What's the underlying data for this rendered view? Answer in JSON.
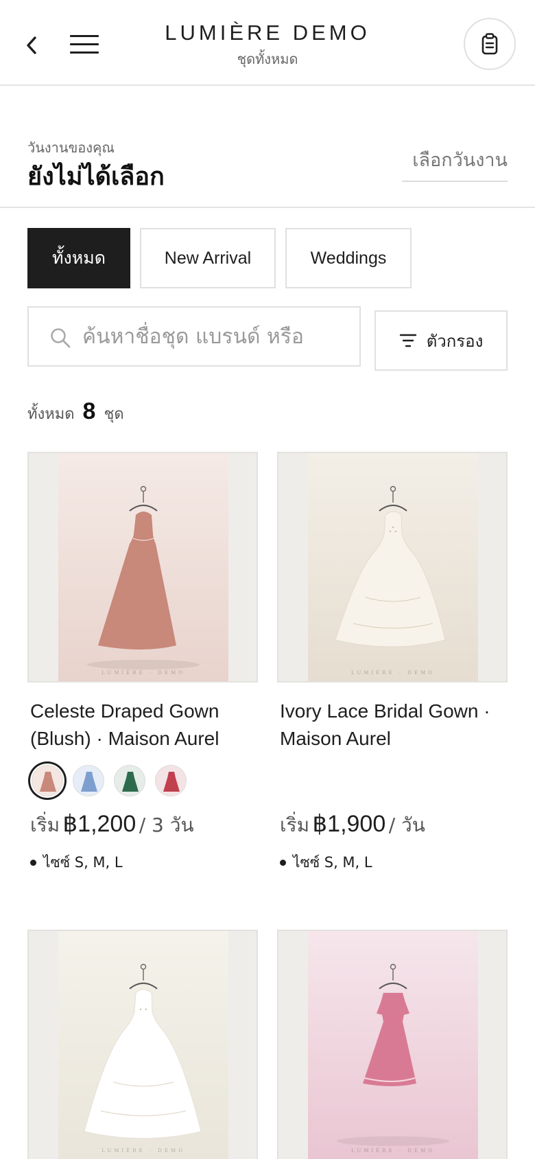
{
  "header": {
    "brand": "LUMIÈRE DEMO",
    "subtitle": "ชุดทั้งหมด"
  },
  "event_date": {
    "label": "วันงานของคุณ",
    "value": "ยังไม่ได้เลือก",
    "action": "เลือกวันงาน"
  },
  "tabs": [
    {
      "label": "ทั้งหมด",
      "active": true
    },
    {
      "label": "New Arrival",
      "active": false
    },
    {
      "label": "Weddings",
      "active": false
    }
  ],
  "search": {
    "placeholder": "ค้นหาชื่อชุด แบรนด์ หรือ",
    "value": ""
  },
  "filter": {
    "label": "ตัวกรอง"
  },
  "results": {
    "prefix": "ทั้งหมด",
    "count": "8",
    "unit": "ชุด"
  },
  "products": [
    {
      "title": "Celeste Draped Gown (Blush) · Maison Aurel",
      "watermark": "LUMIÈRE · DEMO",
      "price_prefix": "เริ่ม",
      "price": "฿1,200",
      "price_per": "/ 3 วัน",
      "sizes": "ไซซ์ S, M, L",
      "swatches": [
        "blush",
        "blue",
        "green",
        "red"
      ],
      "colors": {
        "dress": "#c8887a",
        "bg_top": "#f5eae6",
        "bg_bottom": "#e8d3cc"
      }
    },
    {
      "title": "Ivory Lace Bridal Gown · Maison Aurel",
      "watermark": "LUMIÈRE · DEMO",
      "price_prefix": "เริ่ม",
      "price": "฿1,900",
      "price_per": "/ วัน",
      "sizes": "ไซซ์ S, M, L",
      "swatches": [],
      "colors": {
        "dress": "#f7f3ea",
        "bg_top": "#f3efe7",
        "bg_bottom": "#e6ddd0"
      }
    },
    {
      "title": "",
      "watermark": "LUMIÈRE · DEMO",
      "colors": {
        "dress": "#ffffff",
        "bg_top": "#f4f2ea",
        "bg_bottom": "#e9e5da"
      }
    },
    {
      "title": "",
      "watermark": "LUMIÈRE · DEMO",
      "colors": {
        "dress": "#d97a94",
        "bg_top": "#f6e6ec",
        "bg_bottom": "#e9c5d2"
      }
    }
  ],
  "swatch_colors": {
    "blush": "#c8887a",
    "blue": "#7c9fd0",
    "green": "#2e6b4e",
    "red": "#c0404e"
  }
}
